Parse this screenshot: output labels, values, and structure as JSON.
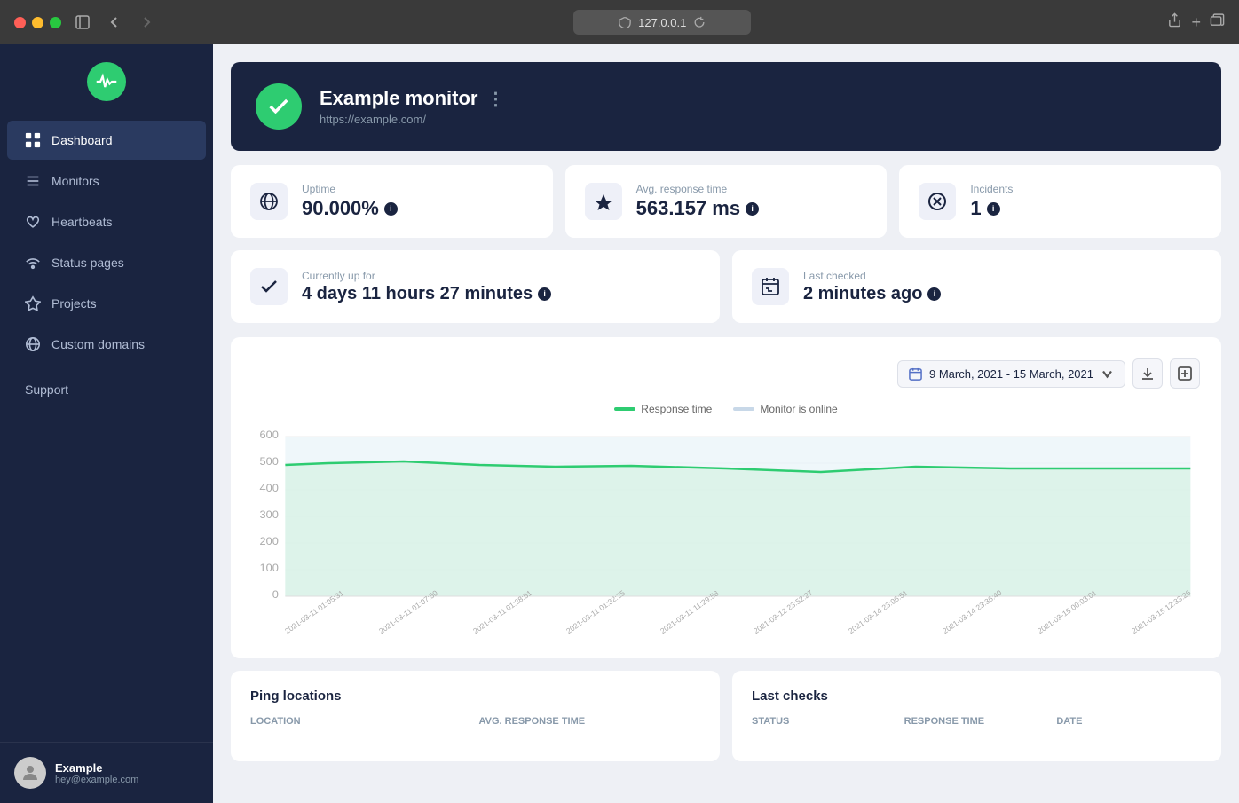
{
  "browser": {
    "address": "127.0.0.1",
    "shield_icon": "shield",
    "refresh_icon": "refresh"
  },
  "sidebar": {
    "logo_alt": "Heartbeat monitor logo",
    "nav_items": [
      {
        "id": "dashboard",
        "label": "Dashboard",
        "icon": "grid"
      },
      {
        "id": "monitors",
        "label": "Monitors",
        "icon": "list"
      },
      {
        "id": "heartbeats",
        "label": "Heartbeats",
        "icon": "heart"
      },
      {
        "id": "status-pages",
        "label": "Status pages",
        "icon": "wifi"
      },
      {
        "id": "projects",
        "label": "Projects",
        "icon": "tool"
      },
      {
        "id": "custom-domains",
        "label": "Custom domains",
        "icon": "globe"
      }
    ],
    "support_label": "Support",
    "user": {
      "name": "Example",
      "email": "hey@example.com"
    }
  },
  "monitor": {
    "name": "Example monitor",
    "url": "https://example.com/",
    "status": "up"
  },
  "stats": {
    "uptime_label": "Uptime",
    "uptime_value": "90.000%",
    "avg_response_label": "Avg. response time",
    "avg_response_value": "563.157 ms",
    "incidents_label": "Incidents",
    "incidents_value": "1"
  },
  "status_cards": {
    "currently_up_label": "Currently up for",
    "currently_up_value": "4 days 11 hours 27 minutes",
    "last_checked_label": "Last checked",
    "last_checked_value": "2 minutes ago"
  },
  "chart": {
    "date_range": "9 March, 2021 - 15 March, 2021",
    "legend": [
      {
        "label": "Response time",
        "color": "#2ecc71"
      },
      {
        "label": "Monitor is online",
        "color": "#c8d8e8"
      }
    ],
    "y_axis": [
      "600",
      "500",
      "400",
      "300",
      "200",
      "100",
      "0"
    ],
    "x_axis": [
      "2021-03-11 01:05:31",
      "2021-03-11 01:07:50",
      "2021-03-11 01:28:51",
      "2021-03-11 01:32:25",
      "2021-03-11 11:29:58",
      "2021-03-12 23:52:27",
      "2021-03-14 23:06:51",
      "2021-03-14 23:36:40",
      "2021-03-15 00:03:01",
      "2021-03-15 12:33:26"
    ]
  },
  "ping_locations": {
    "title": "Ping locations",
    "columns": [
      "Location",
      "Avg. response time"
    ]
  },
  "last_checks": {
    "title": "Last checks",
    "columns": [
      "Status",
      "Response time",
      "Date"
    ]
  }
}
